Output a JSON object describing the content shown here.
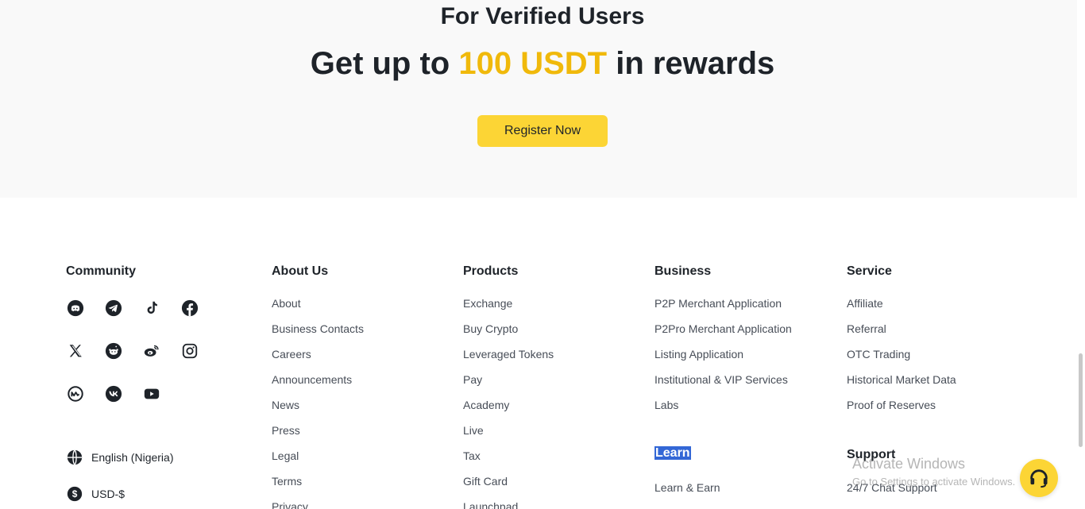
{
  "hero": {
    "subtitle": "For Verified Users",
    "title_prefix": "Get up to ",
    "title_highlight": "100 USDT",
    "title_suffix": " in rewards",
    "register_label": "Register Now"
  },
  "community": {
    "heading": "Community",
    "icons": [
      "discord-icon",
      "telegram-icon",
      "tiktok-icon",
      "facebook-icon",
      "x-icon",
      "reddit-icon",
      "weibo-icon",
      "instagram-icon",
      "coinmarketcap-icon",
      "vk-icon",
      "youtube-icon"
    ],
    "language": "English (Nigeria)",
    "currency": "USD-$"
  },
  "about": {
    "heading": "About Us",
    "items": [
      "About",
      "Business Contacts",
      "Careers",
      "Announcements",
      "News",
      "Press",
      "Legal",
      "Terms",
      "Privacy"
    ]
  },
  "products": {
    "heading": "Products",
    "items": [
      "Exchange",
      "Buy Crypto",
      "Leveraged Tokens",
      "Pay",
      "Academy",
      "Live",
      "Tax",
      "Gift Card",
      "Launchpad"
    ]
  },
  "business": {
    "heading": "Business",
    "items": [
      "P2P Merchant Application",
      "P2Pro Merchant Application",
      "Listing Application",
      "Institutional & VIP Services",
      "Labs"
    ],
    "learn_heading": "Learn",
    "learn_items": [
      "Learn & Earn"
    ]
  },
  "service": {
    "heading": "Service",
    "items": [
      "Affiliate",
      "Referral",
      "OTC Trading",
      "Historical Market Data",
      "Proof of Reserves"
    ],
    "support_heading": "Support",
    "support_items": [
      "24/7 Chat Support"
    ]
  },
  "overlay": {
    "activate_title": "Activate Windows",
    "activate_sub": "Go to Settings to activate Windows."
  },
  "colors": {
    "accent": "#f0b90b",
    "button": "#fcd535",
    "text": "#1e2329",
    "selection": "#3367d6"
  }
}
